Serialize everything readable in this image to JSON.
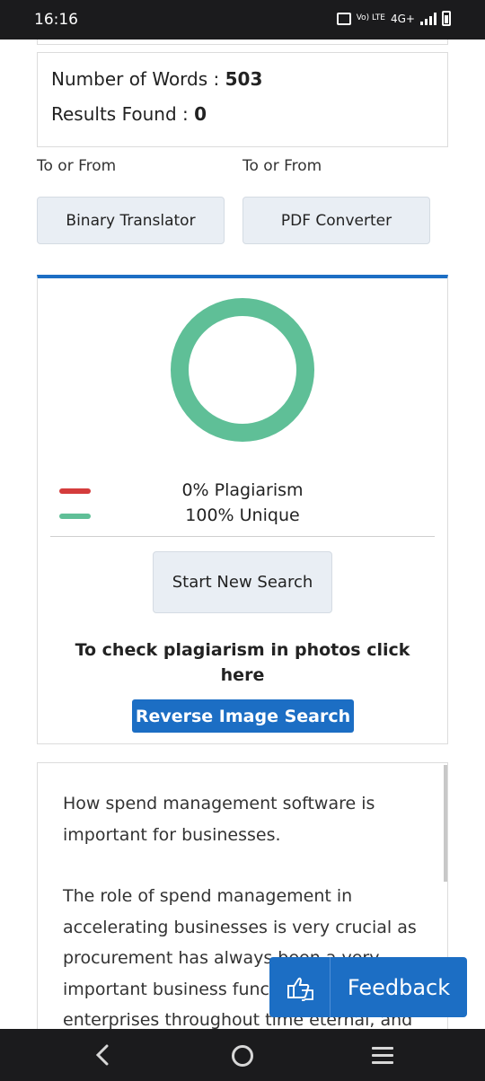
{
  "status_bar": {
    "time": "16:16",
    "volte": "Vo) LTE",
    "network": "4G+",
    "icons": [
      "vibrate-icon",
      "volte-icon",
      "signal-icon",
      "battery-icon"
    ]
  },
  "stats": {
    "words_label": "Number of Words : ",
    "words_value": "503",
    "results_label": "Results Found : ",
    "results_value": "0"
  },
  "tools": [
    {
      "label": "To or From",
      "button": "Binary Translator"
    },
    {
      "label": "To or From",
      "button": "PDF Converter"
    }
  ],
  "result": {
    "plagiarism_text": "0% Plagiarism",
    "unique_text": "100% Unique",
    "plagiarism_percent": 0,
    "unique_percent": 100,
    "start_button": "Start New Search",
    "photo_prompt": "To check plagiarism in photos click here",
    "reverse_button": "Reverse Image Search"
  },
  "article": {
    "paragraphs": [
      "How spend management software is important for businesses.",
      "The role of spend management in accelerating businesses is very crucial as procurement has always been a very important business function for enterprises throughout time eternal, and"
    ]
  },
  "feedback": {
    "label": "Feedback",
    "icon": "feedback-icon"
  },
  "nav": {
    "icons": [
      "back-icon",
      "home-icon",
      "recent-apps-icon"
    ]
  },
  "colors": {
    "accent": "#1c6ec4",
    "unique_green": "#5fbf97",
    "plagiarism_red": "#d43c3c",
    "button_bg": "#e9eef4"
  }
}
